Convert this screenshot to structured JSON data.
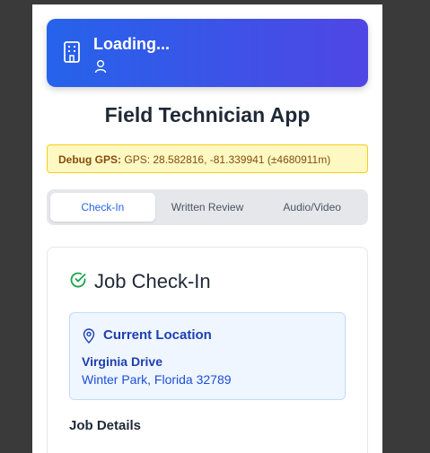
{
  "header": {
    "title": "Loading...",
    "icon": "building-icon",
    "user_icon": "user-icon",
    "gradient": [
      "#2563eb",
      "#4f46e5"
    ]
  },
  "app_title": "Field Technician App",
  "debug": {
    "label": "Debug GPS:",
    "value": "GPS: 28.582816, -81.339941 (±4680911m)"
  },
  "tabs": [
    {
      "label": "Check-In",
      "active": true
    },
    {
      "label": "Written Review",
      "active": false
    },
    {
      "label": "Audio/Video",
      "active": false
    }
  ],
  "checkin": {
    "title": "Job Check-In",
    "icon": "check-circle-icon",
    "location": {
      "heading": "Current Location",
      "icon": "map-pin-icon",
      "street": "Virginia Drive",
      "city": "Winter Park, Florida 32789"
    },
    "job_details_heading": "Job Details"
  },
  "colors": {
    "accent": "#2563eb",
    "success": "#16a34a",
    "debug_bg": "#fef9c3"
  }
}
